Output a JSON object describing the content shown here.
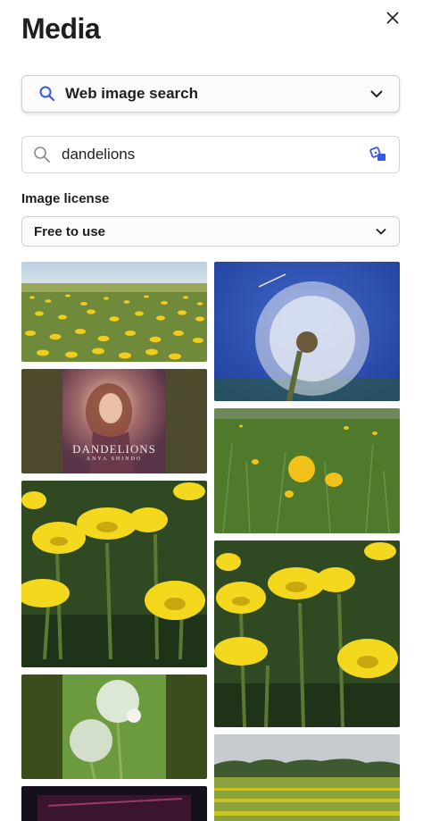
{
  "panel": {
    "title": "Media"
  },
  "source": {
    "label": "Web image search"
  },
  "search": {
    "value": "dandelions",
    "placeholder": "Search"
  },
  "license": {
    "label": "Image license",
    "selected": "Free to use"
  },
  "results": {
    "items": [
      {
        "name": "Dandelion meadow under pale sky"
      },
      {
        "name": "Dandelion seed head against blue sky"
      },
      {
        "name": "Dandelions book cover",
        "title": "DANDELIONS",
        "author": "ANYA SHINDO"
      },
      {
        "name": "Single dandelion in grass"
      },
      {
        "name": "Yellow dandelions close-up"
      },
      {
        "name": "Yellow dandelion flowers in grass"
      },
      {
        "name": "Dandelion seed clocks"
      },
      {
        "name": "Dandelion field with trees"
      },
      {
        "name": "Dark purple image"
      }
    ]
  },
  "colors": {
    "accent": "#3858e9",
    "text": "#1e1e1e",
    "border": "#d0d0d0"
  }
}
